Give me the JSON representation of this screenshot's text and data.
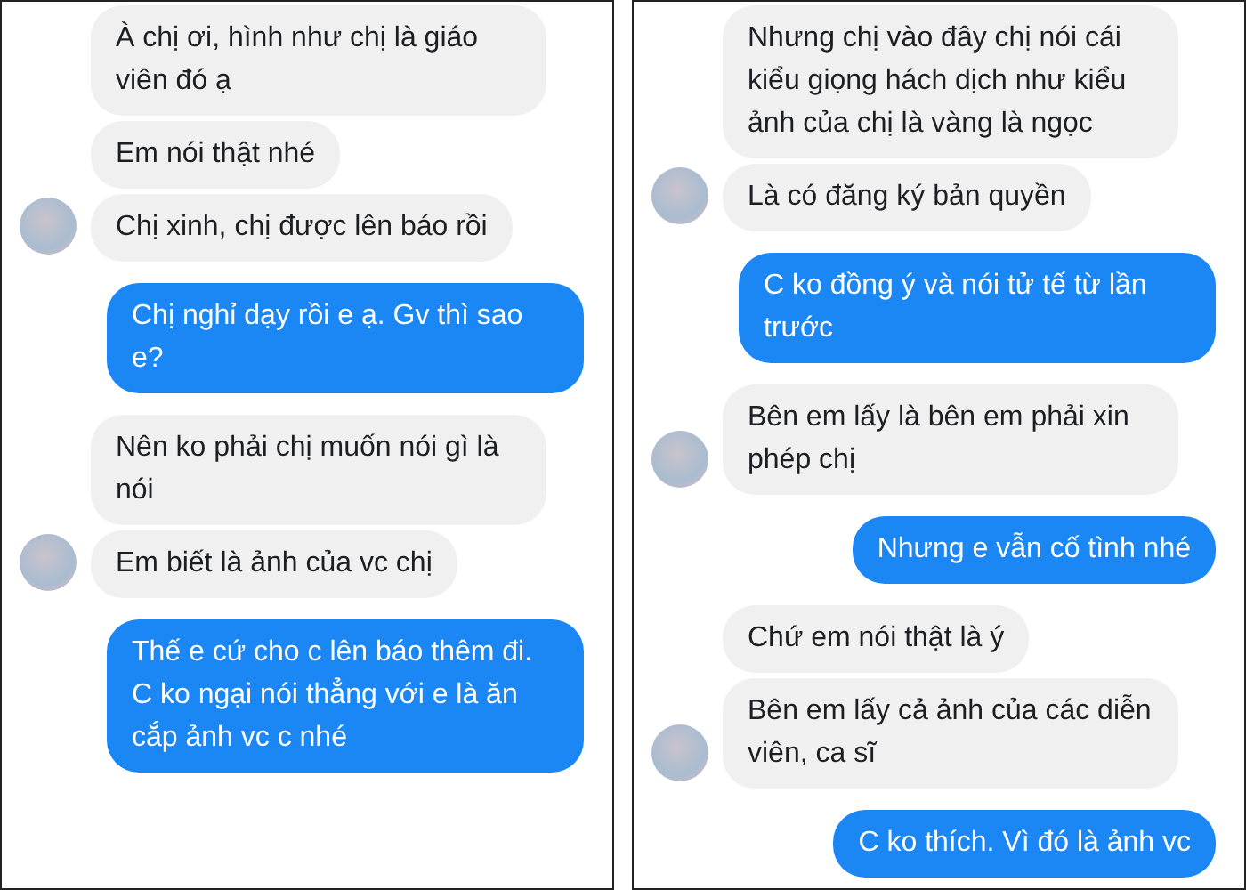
{
  "panels": [
    {
      "messages": [
        {
          "kind": "incoming",
          "text": "À chị ơi, hình như chị là giáo viên đó ạ",
          "avatar": false
        },
        {
          "kind": "incoming",
          "text": "Em nói thật nhé",
          "avatar": false
        },
        {
          "kind": "incoming",
          "text": "Chị xinh, chị được lên báo rồi",
          "avatar": true
        },
        {
          "kind": "outgoing",
          "text": "Chị nghỉ dạy rồi e ạ. Gv thì sao e?"
        },
        {
          "kind": "incoming",
          "text": "Nên ko phải chị muốn nói gì là nói",
          "avatar": false
        },
        {
          "kind": "incoming",
          "text": "Em biết là ảnh của vc chị",
          "avatar": true
        },
        {
          "kind": "outgoing",
          "text": "Thế e cứ cho c lên báo thêm đi. C ko ngại nói thẳng với e là ăn cắp ảnh vc c nhé"
        }
      ]
    },
    {
      "messages": [
        {
          "kind": "incoming",
          "text": "Nhưng chị vào đây chị nói cái kiểu giọng hách dịch như kiểu ảnh của chị là vàng là ngọc",
          "avatar": false
        },
        {
          "kind": "incoming",
          "text": "Là có đăng ký bản quyền",
          "avatar": true
        },
        {
          "kind": "outgoing",
          "text": "C ko đồng ý và nói tử tế từ lần trước"
        },
        {
          "kind": "incoming",
          "text": "Bên em lấy là bên em phải xin phép chị",
          "avatar": true
        },
        {
          "kind": "outgoing",
          "text": "Nhưng e vẫn cố tình nhé"
        },
        {
          "kind": "incoming",
          "text": "Chứ em nói thật là ý",
          "avatar": false
        },
        {
          "kind": "incoming",
          "text": "Bên em lấy cả ảnh của các diễn viên, ca sĩ",
          "avatar": true
        },
        {
          "kind": "outgoing",
          "text": "C ko thích. Vì đó là ảnh vc"
        }
      ]
    }
  ]
}
